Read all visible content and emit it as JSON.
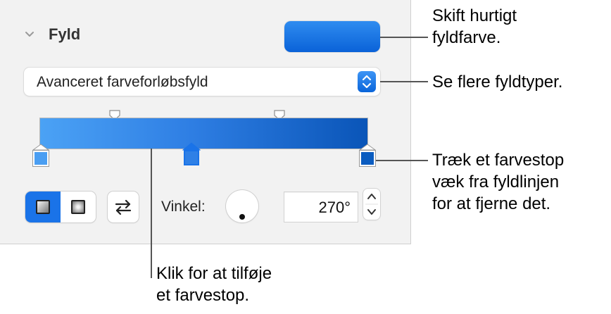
{
  "panel": {
    "section_title": "Fyld",
    "collapse_icon": "chevron-down-icon",
    "fill_color": "#1a6fe0",
    "fill_type": {
      "selected": "Avanceret farveforløbsfyld",
      "popup_icon": "up-down-chevron-icon",
      "accent": "#1a73e8"
    },
    "gradient": {
      "start_color": "#4ba2f5",
      "end_color": "#0a55b8",
      "stops": [
        {
          "color": "#4a9ef2",
          "selected": false
        },
        {
          "color": "#2f80e6",
          "selected": true
        },
        {
          "color": "#0a5cc0",
          "selected": false
        }
      ]
    },
    "gradient_type_buttons": [
      {
        "name": "linear-gradient-icon",
        "active": true
      },
      {
        "name": "radial-gradient-icon",
        "active": false
      }
    ],
    "reverse_icon": "swap-arrows-icon",
    "angle_label": "Vinkel:",
    "angle_value": "270°",
    "stepper_icon": "up-down-stepper-icon"
  },
  "callouts": {
    "color_well": [
      "Skift hurtigt",
      "fyldfarve."
    ],
    "fill_types": [
      "Se flere fyldtyper."
    ],
    "color_stop": [
      "Træk et farvestop",
      "væk fra fyldlinjen",
      "for at fjerne det."
    ],
    "add_stop": [
      "Klik for at tilføje",
      "et farvestop."
    ]
  }
}
